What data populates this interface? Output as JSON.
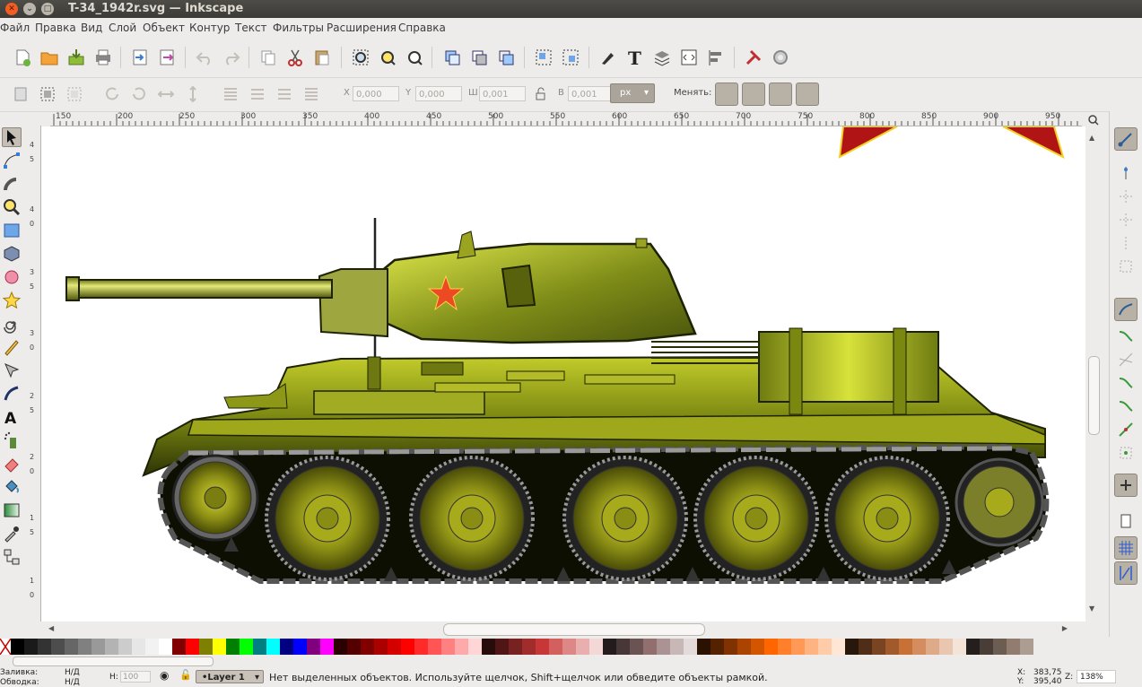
{
  "window": {
    "title": "T-34_1942r.svg — Inkscape"
  },
  "menu": [
    "Файл",
    "Правка",
    "Вид",
    "Слой",
    "Объект",
    "Контур",
    "Текст",
    "Фильтры",
    "Расширения",
    "Справка"
  ],
  "toolbar2": {
    "x_label": "X",
    "x_value": "0,000",
    "y_label": "Y",
    "y_value": "0,000",
    "w_label": "Ш",
    "w_value": "0,001",
    "h_label": "В",
    "h_value": "0,001",
    "unit": "px",
    "change_label": "Менять:"
  },
  "ruler_h_ticks": [
    "150",
    "200",
    "250",
    "300",
    "350",
    "400",
    "450",
    "500",
    "550",
    "600",
    "650",
    "700",
    "750",
    "800",
    "850",
    "900",
    "950"
  ],
  "ruler_v_ticks": [
    "4",
    "5",
    "4",
    "0",
    "3",
    "5",
    "3",
    "0",
    "2",
    "5",
    "2",
    "0",
    "1",
    "5",
    "1",
    "0"
  ],
  "palette": [
    "#000000",
    "#1a1a1a",
    "#333333",
    "#4d4d4d",
    "#666666",
    "#808080",
    "#999999",
    "#b3b3b3",
    "#cccccc",
    "#e6e6e6",
    "#f2f2f2",
    "#ffffff",
    "#800000",
    "#ff0000",
    "#808000",
    "#ffff00",
    "#008000",
    "#00ff00",
    "#008080",
    "#00ffff",
    "#000080",
    "#0000ff",
    "#800080",
    "#ff00ff",
    "#2b0000",
    "#550000",
    "#800000",
    "#aa0000",
    "#d40000",
    "#ff0000",
    "#ff2a2a",
    "#ff5555",
    "#ff8080",
    "#ffaaaa",
    "#ffd5d5",
    "#280b0b",
    "#501616",
    "#782121",
    "#a02c2c",
    "#c83737",
    "#d35f5f",
    "#de8787",
    "#e9afaf",
    "#f4d7d7",
    "#241c1c",
    "#483737",
    "#6c5353",
    "#916f6f",
    "#ac9393",
    "#c8b7b7",
    "#e3dbdb",
    "#2b1100",
    "#552200",
    "#803300",
    "#aa4400",
    "#d45500",
    "#ff6600",
    "#ff7f2a",
    "#ff9955",
    "#ffb380",
    "#ffccaa",
    "#ffe6d5",
    "#28170b",
    "#502d16",
    "#784421",
    "#a05a2c",
    "#c87137",
    "#d38d5f",
    "#deaa87",
    "#e9c6af",
    "#f4e3d7",
    "#241f1c",
    "#483e37",
    "#6c5d53",
    "#917c6f",
    "#ac9d93"
  ],
  "status": {
    "fill_label": "Заливка:",
    "fill_value": "Н/Д",
    "stroke_label": "Обводка:",
    "stroke_value": "Н/Д",
    "opacity_label": "Н:",
    "opacity_value": "100",
    "layer": "•Layer 1",
    "message": "Нет выделенных объектов. Используйте щелчок, Shift+щелчок или обведите объекты рамкой.",
    "x_label": "X:",
    "x_value": "383,75",
    "y_label": "Y:",
    "y_value": "395,40",
    "zoom_label": "Z:",
    "zoom_value": "138%"
  },
  "colors": {
    "tank_green": "#9aa81a",
    "star": "#e83a1f",
    "track": "#3a3a3a"
  }
}
